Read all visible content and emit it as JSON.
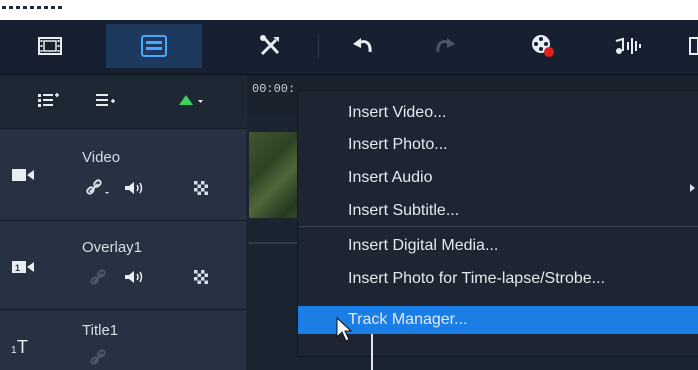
{
  "timeline": {
    "timecode": "00:00:"
  },
  "tracks": [
    {
      "label": "Video",
      "icon": "video-track-icon"
    },
    {
      "label": "Overlay1",
      "icon": "overlay-track-icon"
    },
    {
      "label": "Title1",
      "icon": "title-track-icon"
    }
  ],
  "context_menu": {
    "items": [
      "Insert Video...",
      "Insert Photo...",
      "Insert Audio",
      "Insert Subtitle...",
      "Insert Digital Media...",
      "Insert Photo for Time-lapse/Strobe...",
      "Track Manager..."
    ],
    "highlighted": "Track Manager..."
  },
  "colors": {
    "frame_bg": "#1e2734",
    "track_bg": "#263242",
    "menu_bg": "#1d2532",
    "highlight": "#1a7ee6",
    "accent_green": "#3ccf5a",
    "accent_red": "#e2211c",
    "active_tab": "#1d3a5e"
  }
}
